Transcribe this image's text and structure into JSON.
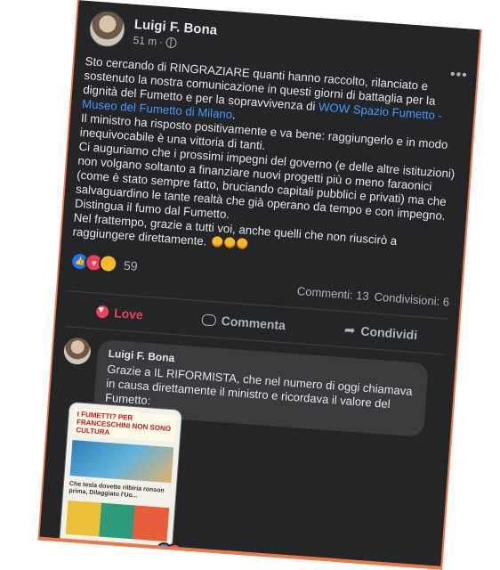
{
  "post": {
    "author": "Luigi F. Bona",
    "time": "51 m",
    "body": [
      {
        "text": "Sto cercando di RINGRAZIARE quanti hanno raccolto, rilanciato e sostenuto la nostra comunicazione in questi giorni di battaglia per la dignità del Fumetto e per la sopravvivenza di "
      },
      {
        "link": "WOW Spazio Fumetto - Museo del Fumetto di Milano"
      },
      {
        "text": "."
      },
      {
        "text2": "Il ministro ha risposto positivamente e va bene: raggiungerlo e in modo inequivocabile è una vittoria di tanti."
      },
      {
        "text3": "Ci auguriamo che i prossimi impegni del governo (e delle altre istituzioni) non volgano soltanto a finanziare nuovi progetti più o meno faraonici (come è stato sempre fatto, bruciando capitali pubblici e privati) ma che salvaguardino le tante realtà che già operano da tempo e con impegno."
      },
      {
        "text4": "Distingua il fumo dal Fumetto."
      },
      {
        "text5": "Nel frattempo, grazie a tutti voi, anche quelli che non riuscirò a raggiungere direttamente."
      }
    ],
    "reaction_count": "59",
    "comments_label": "Commenti: 13",
    "shares_label": "Condivisioni: 6"
  },
  "actions": {
    "love": "Love",
    "comment": "Commenta",
    "share": "Condividi"
  },
  "comment": {
    "author": "Luigi F. Bona",
    "text": "Grazie a IL RIFORMISTA, che nel numero di oggi chiamava in causa direttamente il ministro e ricordava il valore del Fumetto:"
  },
  "newspaper": {
    "headline": "I FUMETTI? PER FRANCESCHINI NON SONO CULTURA",
    "sub": "Che tesla dovette rilbiria ronson prima, Dilaggiato l'Uo..."
  },
  "icons": [
    "globe-icon",
    "more-icon",
    "heart-icon",
    "comment-icon",
    "share-icon",
    "like-reaction-icon",
    "love-reaction-icon",
    "care-reaction-icon"
  ],
  "colors": {
    "background": "#242526",
    "frame": "#e8794a",
    "link": "#4599ff",
    "love": "#f33e58"
  }
}
